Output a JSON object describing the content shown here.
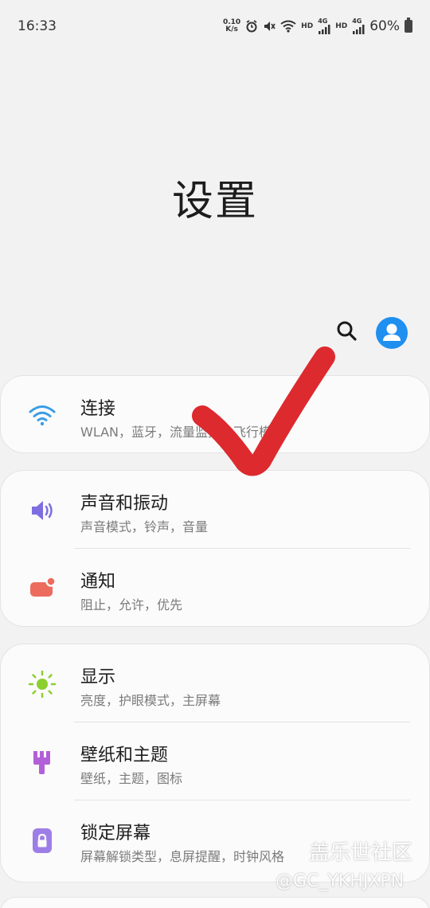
{
  "status_bar": {
    "time": "16:33",
    "net_speed_value": "0.10",
    "net_speed_unit": "K/s",
    "sim1_label": "HD",
    "sim1_tech": "4G",
    "sim2_label": "HD",
    "sim2_tech": "4G",
    "battery_percent": "60%"
  },
  "header": {
    "title": "设置"
  },
  "sections": [
    {
      "items": [
        {
          "title": "连接",
          "subtitle": "WLAN，蓝牙，流量监控，飞行模式",
          "icon": "wifi-icon"
        }
      ]
    },
    {
      "items": [
        {
          "title": "声音和振动",
          "subtitle": "声音模式，铃声，音量",
          "icon": "speaker-icon"
        },
        {
          "title": "通知",
          "subtitle": "阻止，允许，优先",
          "icon": "notification-icon"
        }
      ]
    },
    {
      "items": [
        {
          "title": "显示",
          "subtitle": "亮度，护眼模式，主屏幕",
          "icon": "sun-icon"
        },
        {
          "title": "壁纸和主题",
          "subtitle": "壁纸，主题，图标",
          "icon": "paintbrush-icon"
        },
        {
          "title": "锁定屏幕",
          "subtitle": "屏幕解锁类型，息屏提醒，时钟风格",
          "icon": "lock-icon"
        }
      ]
    }
  ],
  "watermark": {
    "line1": "盖乐世社区",
    "line2": "@GC_YKHJXPN"
  },
  "colors": {
    "accent": "#1f8ff0",
    "check_mark": "#dd2a2e",
    "background": "#f2f2f2",
    "card": "#fbfbfb"
  }
}
